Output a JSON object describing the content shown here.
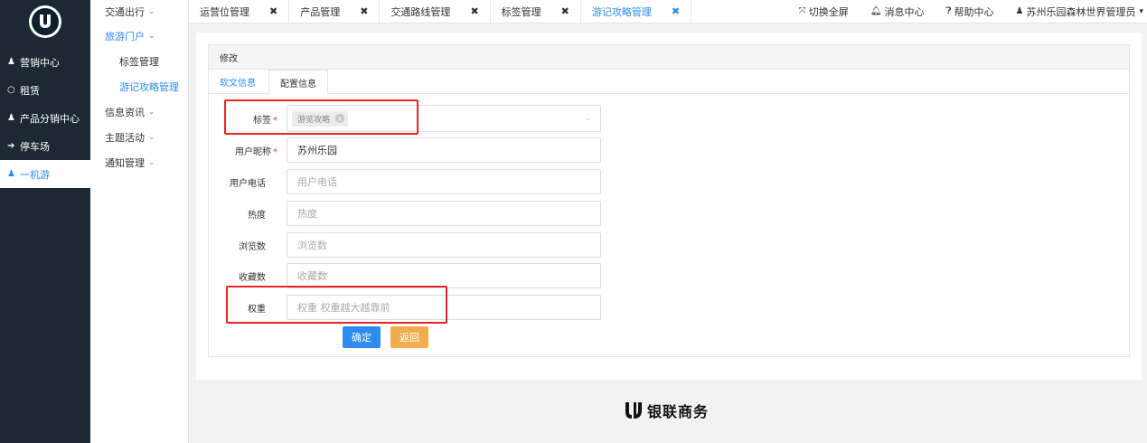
{
  "sidebar": {
    "logo_text": "UMS",
    "items": [
      {
        "icon": "person-icon",
        "label": "营销中心",
        "active": false
      },
      {
        "icon": "circle-icon",
        "label": "租赁",
        "active": false
      },
      {
        "icon": "person-icon",
        "label": "产品分销中心",
        "active": false
      },
      {
        "icon": "arrow-circle-icon",
        "label": "停车场",
        "active": false
      },
      {
        "icon": "person-icon",
        "label": "一机游",
        "active": true
      }
    ]
  },
  "submenu": {
    "items": [
      {
        "label": "交通出行",
        "open": false
      },
      {
        "label": "旅游门户",
        "open": true,
        "children": [
          "标签管理",
          "游记攻略管理"
        ]
      },
      {
        "label": "信息资讯",
        "open": false
      },
      {
        "label": "主题活动",
        "open": false
      },
      {
        "label": "通知管理",
        "open": false
      }
    ]
  },
  "tabs": [
    {
      "label": "运营位管理",
      "active": false
    },
    {
      "label": "产品管理",
      "active": false
    },
    {
      "label": "交通路线管理",
      "active": false
    },
    {
      "label": "标签管理",
      "active": false
    },
    {
      "label": "游记攻略管理",
      "active": true
    }
  ],
  "topright": {
    "fullscreen": "切换全屏",
    "messages": "消息中心",
    "help": "帮助中心",
    "user": "苏州乐园森林世界管理员"
  },
  "panel": {
    "title": "修改",
    "tabs": [
      "软文信息",
      "配置信息"
    ],
    "active_tab": "配置信息"
  },
  "form": {
    "tag_label": "标签",
    "tag_value": "游览攻略",
    "nickname_label": "用户昵称",
    "nickname_value": "苏州乐园",
    "phone_label": "用户电话",
    "phone_placeholder": "用户电话",
    "heat_label": "热度",
    "heat_placeholder": "热度",
    "views_label": "浏览数",
    "views_placeholder": "浏览数",
    "favs_label": "收藏数",
    "favs_placeholder": "收藏数",
    "weight_label": "权重",
    "weight_placeholder": "权重 权重越大越靠前",
    "required_mark": "*"
  },
  "buttons": {
    "confirm": "确定",
    "back": "返回"
  },
  "footer": {
    "brand": "银联商务"
  },
  "colors": {
    "sidebar_bg": "#1c2833",
    "accent": "#2d8cf0",
    "highlight": "#e8262a",
    "back_button": "#f0ad4e",
    "required": "#e4393c"
  }
}
